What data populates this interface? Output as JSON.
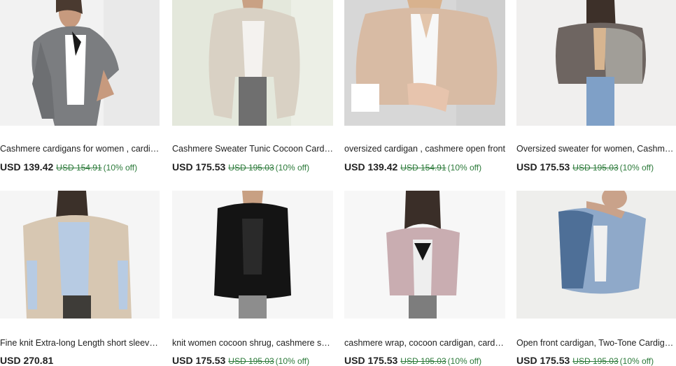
{
  "listings": [
    {
      "title": "Cashmere cardigans for women , cardigan sweater , loose",
      "price": "USD 139.42",
      "original": "USD 154.91",
      "discount": "(10% off)",
      "image": "woman-grey-cardigan"
    },
    {
      "title": "Cashmere Sweater Tunic Cocoon Cardigan",
      "price": "USD 175.53",
      "original": "USD 195.03",
      "discount": "(10% off)",
      "image": "woman-beige-cocoon-cardigan"
    },
    {
      "title": "oversized cardigan , cashmere open front",
      "price": "USD 139.42",
      "original": "USD 154.91",
      "discount": "(10% off)",
      "image": "woman-pink-cardigan"
    },
    {
      "title": "Oversized sweater for women, Cashmere cardigan",
      "price": "USD 175.53",
      "original": "USD 195.03",
      "discount": "(10% off)",
      "image": "woman-two-tone-cardigan"
    },
    {
      "title": "Fine knit Extra-long Length short sleeve cardigan",
      "price": "USD 270.81",
      "original": "",
      "discount": "",
      "image": "woman-long-knit-cardigan"
    },
    {
      "title": "knit women cocoon shrug, cashmere shrug",
      "price": "USD 175.53",
      "original": "USD 195.03",
      "discount": "(10% off)",
      "image": "woman-black-shrug"
    },
    {
      "title": "cashmere wrap, cocoon cardigan, cardigan for women",
      "price": "USD 175.53",
      "original": "USD 195.03",
      "discount": "(10% off)",
      "image": "woman-mauve-wrap"
    },
    {
      "title": "Open front cardigan, Two-Tone Cardigan, blue",
      "price": "USD 175.53",
      "original": "USD 195.03",
      "discount": "(10% off)",
      "image": "woman-blue-cardigan"
    }
  ],
  "colors": {
    "discount_green": "#2c7a3a",
    "text": "#222222"
  }
}
